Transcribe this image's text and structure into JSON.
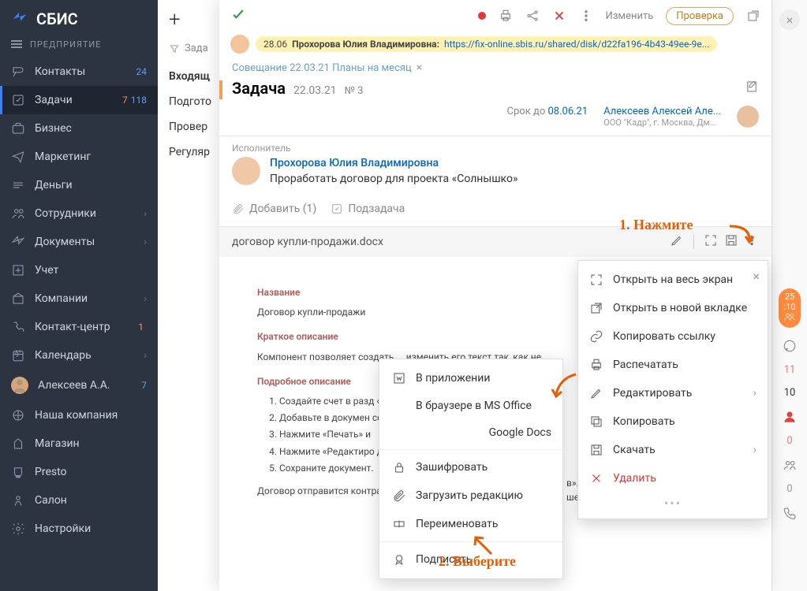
{
  "app": {
    "logo": "СБИС",
    "subtitle": "ПРЕДПРИЯТИЕ"
  },
  "sidebar": [
    {
      "label": "Контакты",
      "badge2": "24"
    },
    {
      "label": "Задачи",
      "badge1": "7",
      "badge2": "118",
      "active": true
    },
    {
      "label": "Бизнес"
    },
    {
      "label": "Маркетинг"
    },
    {
      "label": "Деньги"
    },
    {
      "label": "Сотрудники",
      "chev": true
    },
    {
      "label": "Документы",
      "chev": true
    },
    {
      "label": "Учет"
    },
    {
      "label": "Компании",
      "chev": true
    },
    {
      "label": "Контакт-центр",
      "badge1": "1"
    },
    {
      "label": "Календарь",
      "chev": true,
      "pre": "9"
    },
    {
      "label": "Алексеев А.А.",
      "badge2": "7",
      "avatar": true
    },
    {
      "label": "Наша компания"
    },
    {
      "label": "Магазин"
    },
    {
      "label": "Presto"
    },
    {
      "label": "Салон"
    },
    {
      "label": "Настройки"
    }
  ],
  "filter_label": "Зада",
  "list": [
    "Входящ",
    "Подгото",
    "Провер",
    "Регуляр"
  ],
  "task": {
    "msg_date": "28.06",
    "msg_name": "Прохорова Юлия Владимировна:",
    "msg_link": "https://fix-online.sbis.ru/shared/disk/d22fa196-4b43-49ee-9e...",
    "crumb": "Совещание 22.03.21 Планы на месяц",
    "title": "Задача",
    "date": "22.03.21",
    "num": "№ 3",
    "deadline_lbl": "Срок до ",
    "deadline": "08.06.21",
    "author": "Алексеев Алексей Але...",
    "author_org": "ООО \"Кадр\", г. Москва, Дм...",
    "exec_lbl": "Исполнитель",
    "exec_name": "Прохорова Юлия Владимировна",
    "exec_desc": "Проработать договор для проекта «Солнышко»",
    "attach_add": "Добавить (1)",
    "attach_sub": "Подзадача",
    "doc_name": "договор купли-продажи.docx",
    "change": "Изменить",
    "check": "Проверка"
  },
  "doc": {
    "h1": "Название",
    "p1": "Договор купли-продажи",
    "h2": "Краткое описание",
    "p2": "Компонент позволяет создать ... изменить его текст так, как не",
    "h3": "Подробное описание",
    "ol": [
      "Создайте счет в разд «Бизнес/Продажи/CR",
      "Добавьте в докумен создать.",
      "Нажмите «Печать» и",
      "Нажмите «Редактиро договора, дату, рекви",
      "Сохраните документ."
    ],
    "tail_a": "в».",
    "tail_b": "шей учетной системы, предмет",
    "p3": "Договор отправится контраг"
  },
  "menu1": [
    {
      "t": "Открыть на весь экран",
      "i": "expand"
    },
    {
      "t": "Открыть в новой вкладке",
      "i": "newtab"
    },
    {
      "t": "Копировать ссылку",
      "i": "link"
    },
    {
      "t": "Распечатать",
      "i": "print"
    },
    {
      "t": "Редактировать",
      "i": "edit",
      "chev": true
    },
    {
      "t": "Копировать",
      "i": "copy"
    },
    {
      "t": "Скачать",
      "i": "save",
      "chev": true
    },
    {
      "t": "Удалить",
      "i": "del",
      "danger": true
    }
  ],
  "menu2": [
    {
      "t": "В приложении",
      "i": "word"
    },
    {
      "t": "В браузере в MS Office",
      "noico": true
    },
    {
      "t": "Google Docs",
      "noico": true,
      "right": true
    },
    {
      "hr": true
    },
    {
      "t": "Зашифровать",
      "i": "lock"
    },
    {
      "t": "Загрузить редакцию",
      "i": "clip"
    },
    {
      "t": "Переименовать",
      "i": "rename"
    },
    {
      "hr": true
    },
    {
      "t": "Подписать",
      "i": "sign"
    }
  ],
  "ann": {
    "a1": "1. Нажмите",
    "a2": "2. Выберите"
  },
  "rt": {
    "badge_top": "25",
    "badge_bot": ":10",
    "n1": "11",
    "n2": "10",
    "n3": "0",
    "n4": "0"
  }
}
